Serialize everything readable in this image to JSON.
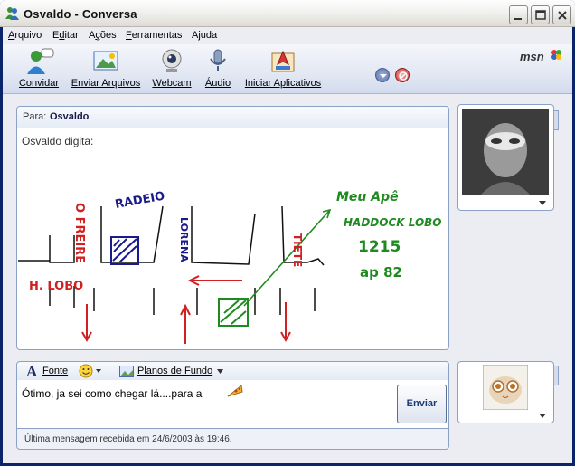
{
  "window": {
    "title": "Osvaldo - Conversa"
  },
  "menu": [
    "Arquivo",
    "Editar",
    "Ações",
    "Ferramentas",
    "Ajuda"
  ],
  "menu_mnemonics": [
    "A",
    "d",
    "ç",
    "F",
    "j"
  ],
  "toolbar": {
    "items": [
      {
        "label": "Convidar",
        "icon": "invite-icon"
      },
      {
        "label": "Enviar Arquivos",
        "icon": "send-files-icon"
      },
      {
        "label": "Webcam",
        "icon": "webcam-icon"
      },
      {
        "label": "Áudio",
        "icon": "audio-icon"
      },
      {
        "label": "Iniciar Aplicativos",
        "icon": "launch-apps-icon"
      }
    ],
    "brand": "msn"
  },
  "conversation": {
    "to_label": "Para:",
    "to_name": "Osvaldo",
    "typing_status": "Osvaldo digita:",
    "ink_drawing": {
      "red_street_labels": [
        "O FREIRE",
        "H. LOBO",
        "TIETE"
      ],
      "blue_labels": [
        "RADEIO",
        "LORENA"
      ],
      "green_note": [
        "Meu Apê",
        "HADDOCK LOBO",
        "1215",
        "ap 82"
      ]
    }
  },
  "formatting": {
    "font_label": "Fonte",
    "emoticon_icon": "smiley-icon",
    "background_label": "Planos de Fundo"
  },
  "compose": {
    "text": "Ótimo, ja sei como chegar lá....para a",
    "send_label": "Enviar"
  },
  "status": {
    "last_message": "Última mensagem recebida em 24/6/2003 às 19:46."
  },
  "colors": {
    "window_frame": "#0a246a",
    "client_bg": "#ecedf2",
    "ink_red": "#d02020",
    "ink_blue": "#1a1a8a",
    "ink_green": "#1f8a1f"
  }
}
